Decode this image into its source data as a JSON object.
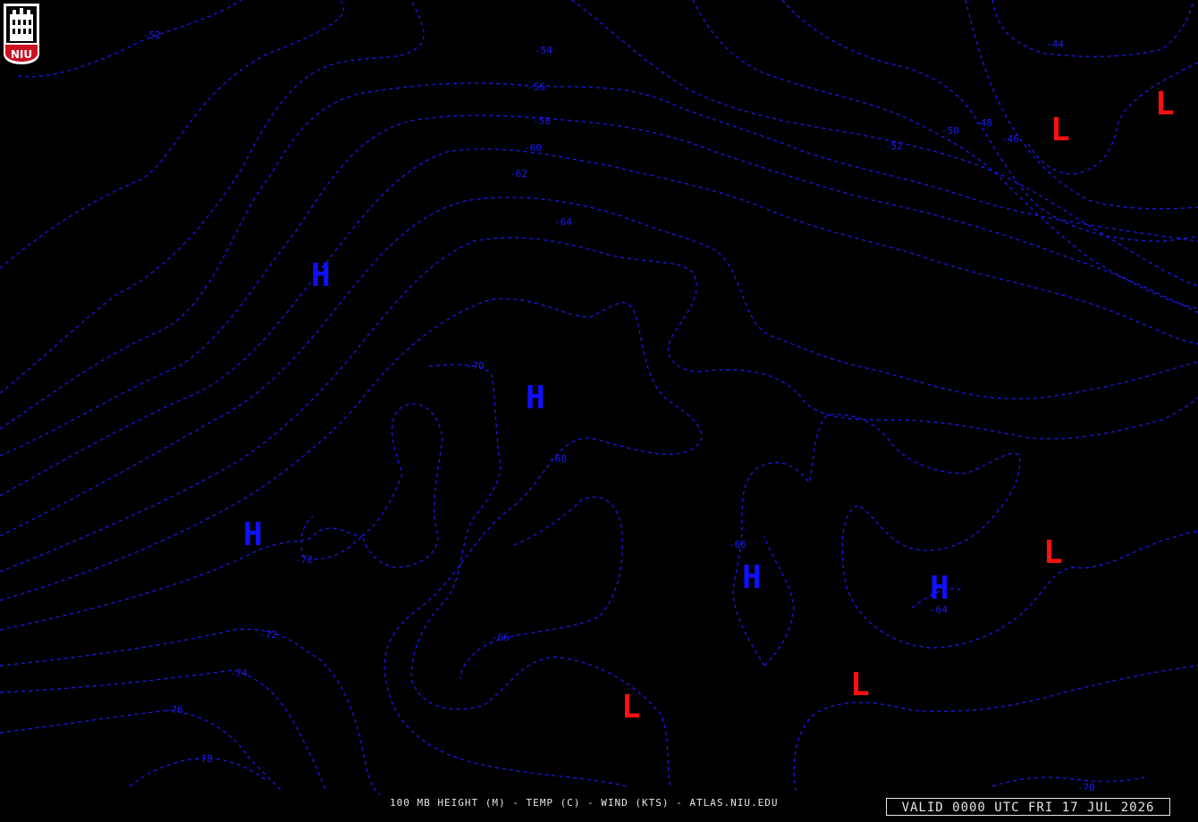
{
  "map": {
    "footer_text": "100 MB HEIGHT (M) - TEMP (C) - WIND (KTS) - ATLAS.NIU.EDU",
    "valid_time": "VALID 0000 UTC FRI 17 JUL 2026",
    "logo_text": "NIU",
    "isotherm_color": "#1a1aff",
    "high_color": "#1010ff",
    "low_color": "#ff1010",
    "contour_labels": [
      "-52",
      "-54",
      "-56",
      "-58",
      "-60",
      "-62",
      "-64",
      "-70",
      "-68",
      "-72",
      "-72",
      "-74",
      "-76",
      "-78",
      "-66",
      "-66",
      "-64",
      "-50",
      "-48",
      "-46",
      "-52",
      "-44",
      "-70"
    ],
    "high_symbol": "H",
    "low_symbol": "L"
  }
}
